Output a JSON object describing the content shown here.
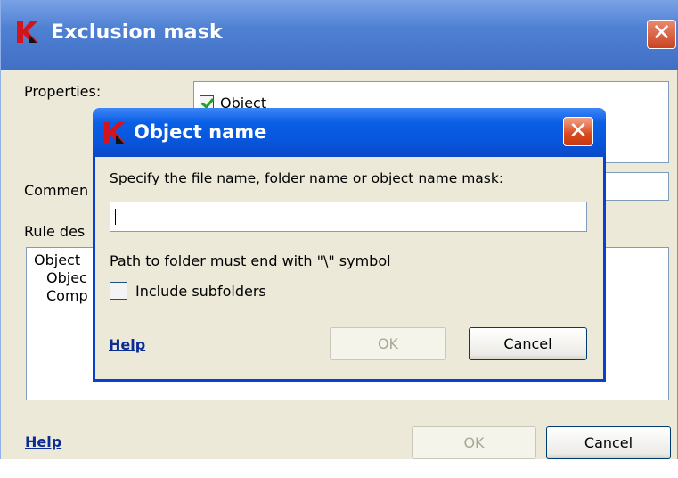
{
  "outer": {
    "title": "Exclusion mask",
    "labels": {
      "properties": "Properties:",
      "comment": "Commen",
      "rule_description": "Rule des"
    },
    "properties_list": [
      {
        "label": "Object",
        "checked": true
      }
    ],
    "rule_lines": [
      "Object",
      "Objec",
      "Comp"
    ],
    "help": "Help",
    "ok": "OK",
    "cancel": "Cancel"
  },
  "dialog": {
    "title": "Object name",
    "prompt": "Specify the file name, folder name or object name mask:",
    "input_value": "",
    "note": "Path to folder must end with \"\\\" symbol",
    "include_subfolders": {
      "label": "Include subfolders",
      "checked": false
    },
    "help": "Help",
    "ok": "OK",
    "cancel": "Cancel"
  },
  "colors": {
    "title_blue": "#0a5fe6",
    "window_face": "#ece9d8",
    "close_red": "#d9481c",
    "link_blue": "#0a2c93",
    "kaspersky_red": "#d4141c"
  },
  "icons": [
    "kaspersky-logo-icon",
    "close-icon",
    "checkmark-icon"
  ]
}
